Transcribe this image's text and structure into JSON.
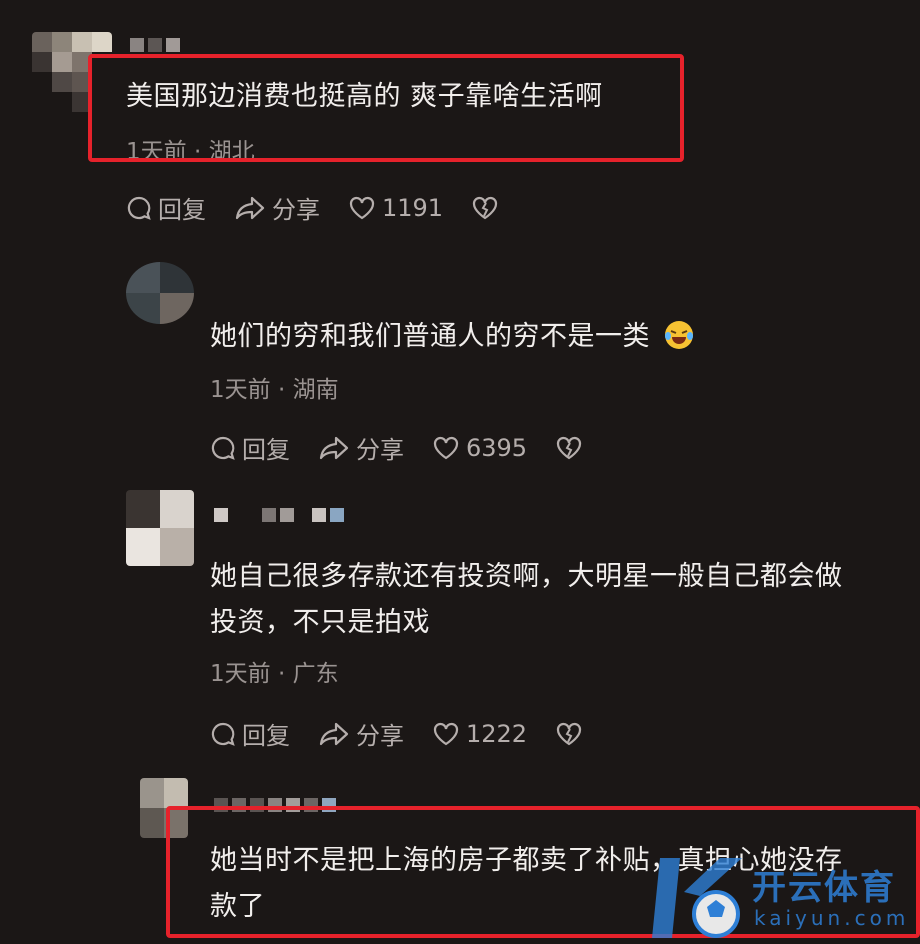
{
  "comments": [
    {
      "text": "美国那边消费也挺高的 爽子靠啥生活啊",
      "time": "1天前",
      "location": "湖北",
      "reply_label": "回复",
      "share_label": "分享",
      "likes": "1191"
    },
    {
      "text": "她们的穷和我们普通人的穷不是一类",
      "time": "1天前",
      "location": "湖南",
      "reply_label": "回复",
      "share_label": "分享",
      "likes": "6395"
    },
    {
      "text_line1": "她自己很多存款还有投资啊，大明星一般自己都会做",
      "text_line2": "投资，不只是拍戏",
      "time": "1天前",
      "location": "广东",
      "reply_label": "回复",
      "share_label": "分享",
      "likes": "1222"
    },
    {
      "text_line1": "她当时不是把上海的房子都卖了补贴，真担心她没存",
      "text_line2": "款了"
    }
  ],
  "separator": " · ",
  "watermark": {
    "brand": "开云体育",
    "url": "kaiyun.com"
  },
  "colors": {
    "highlight": "#e6222b",
    "background": "#1b1716",
    "watermark": "#2e7fd6"
  },
  "icons": [
    "comment-bubble-icon",
    "share-arrow-icon",
    "heart-icon",
    "broken-heart-icon",
    "laughing-crying-emoji-icon"
  ]
}
